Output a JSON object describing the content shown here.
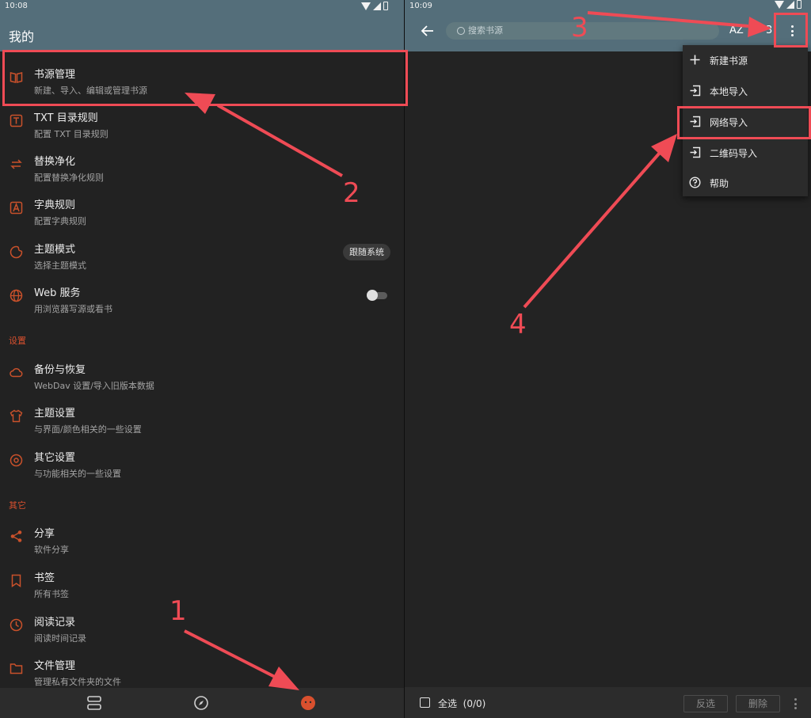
{
  "left": {
    "status": {
      "time": "10:08"
    },
    "appbar": {
      "title": "我的"
    },
    "items": [
      {
        "title": "书源管理",
        "subtitle": "新建、导入、编辑或管理书源",
        "icon": "book-open-icon"
      },
      {
        "title": "TXT 目录规则",
        "subtitle": "配置 TXT 目录规则",
        "icon": "text-box-icon"
      },
      {
        "title": "替换净化",
        "subtitle": "配置替换净化规则",
        "icon": "swap-icon"
      },
      {
        "title": "字典规则",
        "subtitle": "配置字典规则",
        "icon": "dictionary-icon"
      },
      {
        "title": "主题模式",
        "subtitle": "选择主题模式",
        "icon": "theme-icon",
        "chip": "跟随系统"
      },
      {
        "title": "Web 服务",
        "subtitle": "用浏览器写源或看书",
        "icon": "globe-icon",
        "toggle": false
      }
    ],
    "section_settings": "设置",
    "settings_items": [
      {
        "title": "备份与恢复",
        "subtitle": "WebDav 设置/导入旧版本数据",
        "icon": "cloud-icon"
      },
      {
        "title": "主题设置",
        "subtitle": "与界面/颜色相关的一些设置",
        "icon": "shirt-icon"
      },
      {
        "title": "其它设置",
        "subtitle": "与功能相关的一些设置",
        "icon": "settings-icon"
      }
    ],
    "section_other": "其它",
    "other_items": [
      {
        "title": "分享",
        "subtitle": "软件分享",
        "icon": "share-icon"
      },
      {
        "title": "书签",
        "subtitle": "所有书签",
        "icon": "bookmark-icon"
      },
      {
        "title": "阅读记录",
        "subtitle": "阅读时间记录",
        "icon": "clock-icon"
      },
      {
        "title": "文件管理",
        "subtitle": "管理私有文件夹的文件",
        "icon": "folder-icon"
      }
    ],
    "bottom_nav": [
      "bookshelf-icon",
      "compass-icon",
      "profile-icon"
    ]
  },
  "right": {
    "status": {
      "time": "10:09"
    },
    "search": {
      "placeholder": "搜索书源"
    },
    "toolbar": {
      "sort_label": "AZ",
      "partial_label": "3"
    },
    "menu": [
      {
        "label": "新建书源",
        "icon": "plus-icon"
      },
      {
        "label": "本地导入",
        "icon": "import-icon"
      },
      {
        "label": "网络导入",
        "icon": "import-icon"
      },
      {
        "label": "二维码导入",
        "icon": "import-icon"
      },
      {
        "label": "帮助",
        "icon": "help-icon"
      }
    ],
    "bottom": {
      "select_all": "全选",
      "count": "(0/0)",
      "invert": "反选",
      "delete": "删除"
    }
  },
  "annotations": {
    "numbers": [
      "1",
      "2",
      "3",
      "4"
    ],
    "color": "#ef4b55"
  },
  "colors": {
    "appbar": "#546e7a",
    "accent": "#d9502e",
    "background": "#222222"
  }
}
